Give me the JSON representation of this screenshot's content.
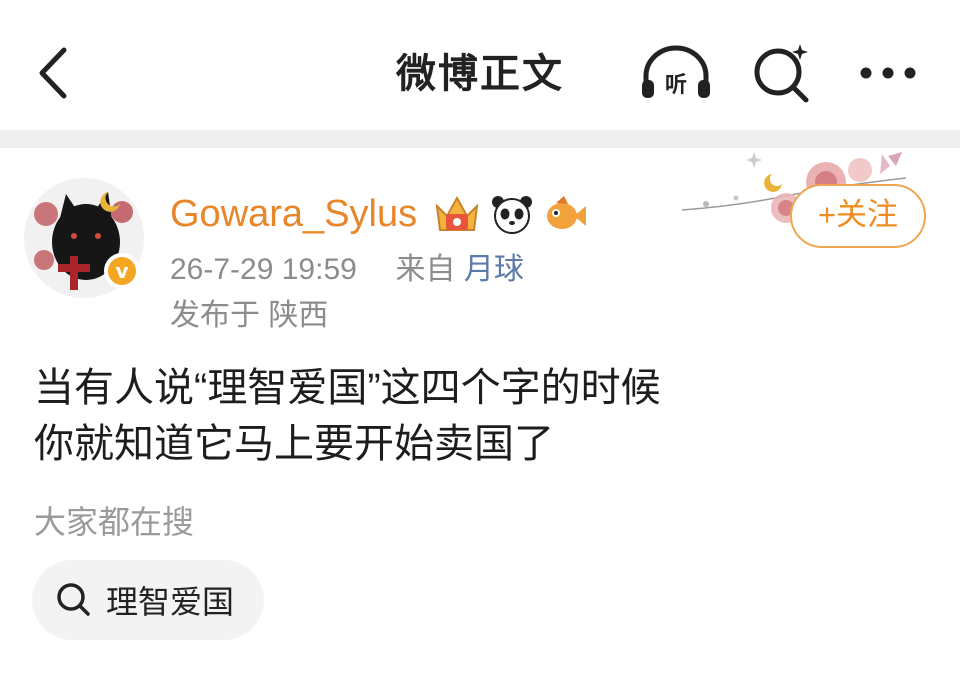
{
  "header": {
    "title": "微博正文",
    "listen_label": "听"
  },
  "post": {
    "username": "Gowara_Sylus",
    "verified_mark": "v",
    "timestamp": "26-7-29 19:59",
    "source_prefix": "来自",
    "source": "月球",
    "location": "发布于 陕西",
    "follow_label": "+关注",
    "content_lines": [
      "当有人说“理智爱国”这四个字的时候",
      "你就知道它马上要开始卖国了"
    ]
  },
  "search": {
    "header": "大家都在搜",
    "chip_label": "理智爱国"
  },
  "colors": {
    "username": "#e8862a",
    "follow": "#f08d22",
    "source": "#5b7bab",
    "divider": "#efefef"
  }
}
